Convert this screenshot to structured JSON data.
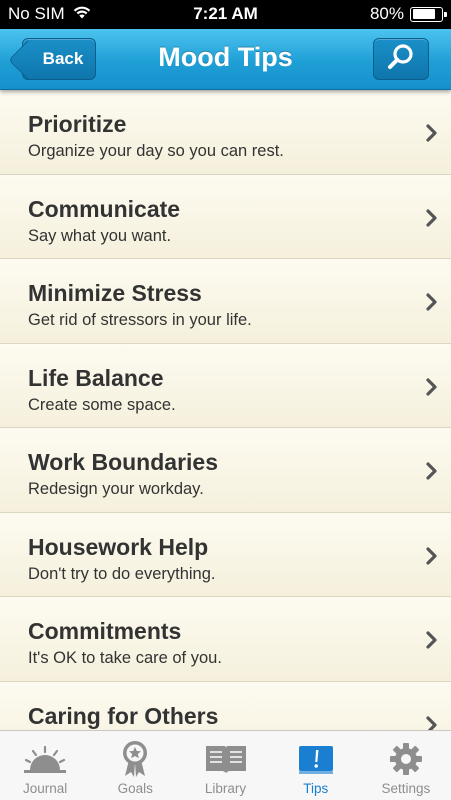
{
  "status_bar": {
    "carrier": "No SIM",
    "time": "7:21 AM",
    "battery": "80%",
    "battery_level": 0.8
  },
  "nav": {
    "title": "Mood Tips",
    "back_label": "Back",
    "search_icon": "search-icon"
  },
  "tips": [
    {
      "title": "Prioritize",
      "subtitle": "Organize your day so you can rest."
    },
    {
      "title": "Communicate",
      "subtitle": "Say what you want."
    },
    {
      "title": "Minimize Stress",
      "subtitle": "Get rid of stressors in your life."
    },
    {
      "title": "Life Balance",
      "subtitle": "Create some space."
    },
    {
      "title": "Work Boundaries",
      "subtitle": "Redesign your workday."
    },
    {
      "title": "Housework Help",
      "subtitle": "Don't try to do everything."
    },
    {
      "title": "Commitments",
      "subtitle": "It's OK to take care of you."
    },
    {
      "title": "Caring for Others",
      "subtitle": ""
    }
  ],
  "tab_bar": {
    "tabs": [
      {
        "label": "Journal",
        "icon": "sunrise-icon",
        "active": false
      },
      {
        "label": "Goals",
        "icon": "award-ribbon-icon",
        "active": false
      },
      {
        "label": "Library",
        "icon": "book-icon",
        "active": false
      },
      {
        "label": "Tips",
        "icon": "exclamation-card-icon",
        "active": true
      },
      {
        "label": "Settings",
        "icon": "gear-icon",
        "active": false
      }
    ]
  },
  "colors": {
    "nav_blue": "#1f9fd6",
    "active_tab": "#1a7fd0",
    "inactive_tab": "#8e8e8e",
    "row_bg": "#f8f4e4"
  }
}
